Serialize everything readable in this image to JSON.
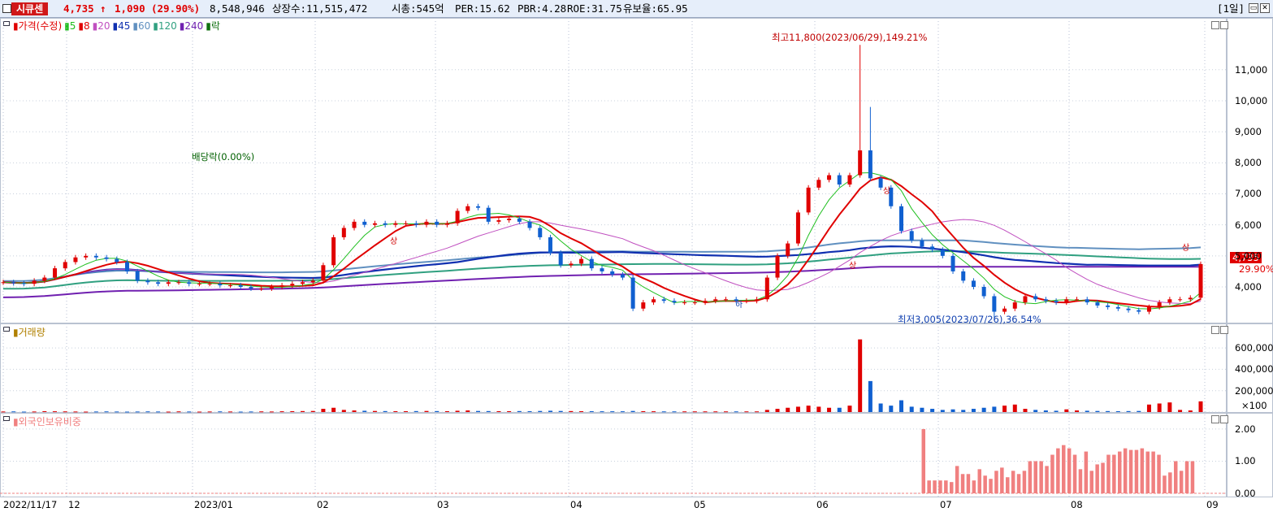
{
  "header": {
    "name": "시큐센",
    "price": "4,735",
    "arrow": "↑",
    "change": "1,090",
    "change_pct": "(29.90%)",
    "volume": "8,548,946",
    "listed_shares": "상장수:11,515,472",
    "market_cap": "시총:545억",
    "per": "PER:15.62",
    "pbr": "PBR:4.28",
    "roe": "ROE:31.75",
    "float": "유보율:65.95",
    "period": "[1일]"
  },
  "price_legend": [
    {
      "label": "가격(수정)",
      "color": "#e00000"
    },
    {
      "label": "5",
      "color": "#1fbf1f"
    },
    {
      "label": "8",
      "color": "#e00000"
    },
    {
      "label": "20",
      "color": "#c050c0"
    },
    {
      "label": "45",
      "color": "#1030b0"
    },
    {
      "label": "60",
      "color": "#6090c0"
    },
    {
      "label": "120",
      "color": "#30a080"
    },
    {
      "label": "240",
      "color": "#7020b0"
    },
    {
      "label": "락",
      "color": "#107010"
    }
  ],
  "volume_legend": {
    "label": "거래량",
    "color": "#b08000"
  },
  "foreign_legend": {
    "label": "외국인보유비중",
    "color": "#f08080"
  },
  "annotations": {
    "high": "최고11,800(2023/06/29),149.21%",
    "low": "최저3,005(2023/07/26),36.54%",
    "dividend": "배당락(0.00%)",
    "current_price": "4,735",
    "current_pct": "29.90%",
    "limit_up": "상",
    "limit_down": "하"
  },
  "chart_data": [
    {
      "type": "candlestick",
      "panel": "price",
      "x": [
        "2022/11/17",
        "12",
        "2023/01",
        "02",
        "03",
        "04",
        "05",
        "06",
        "07",
        "08",
        "09"
      ],
      "y_ticks": [
        "4,000",
        "5,000",
        "6,000",
        "7,000",
        "8,000",
        "9,000",
        "10,000",
        "11,000"
      ],
      "ylim": [
        2900,
        12200
      ],
      "close_series": [
        4150,
        4120,
        4100,
        4200,
        4300,
        4600,
        4800,
        4950,
        5000,
        4950,
        4900,
        4800,
        4500,
        4200,
        4150,
        4100,
        4150,
        4150,
        4100,
        4100,
        4100,
        4050,
        4050,
        4000,
        3950,
        3950,
        4000,
        4050,
        4100,
        4150,
        4200,
        4700,
        5600,
        5900,
        6100,
        6000,
        6050,
        6000,
        6050,
        6050,
        6000,
        6100,
        6000,
        6050,
        6450,
        6600,
        6550,
        6100,
        6150,
        6200,
        6100,
        5900,
        5600,
        5100,
        4700,
        4750,
        4900,
        4600,
        4500,
        4400,
        4300,
        3300,
        3500,
        3600,
        3550,
        3500,
        3500,
        3500,
        3550,
        3600,
        3600,
        3550,
        3550,
        3600,
        4300,
        5000,
        5400,
        6400,
        7200,
        7450,
        7600,
        7300,
        7600,
        8400,
        7500,
        7200,
        6600,
        5800,
        5500,
        5300,
        5200,
        5000,
        4500,
        4200,
        4000,
        3700,
        3200,
        3300,
        3500,
        3700,
        3600,
        3550,
        3500,
        3600,
        3600,
        3500,
        3400,
        3350,
        3300,
        3250,
        3200,
        3350,
        3500,
        3600,
        3600,
        3650,
        4735
      ],
      "high": {
        "value": 11800,
        "date": "2023/06/29",
        "pct": 149.21
      },
      "low": {
        "value": 3005,
        "date": "2023/07/26",
        "pct": 36.54
      },
      "last": 4735
    },
    {
      "type": "bar",
      "panel": "volume",
      "y_ticks": [
        "100",
        "200,000",
        "400,000",
        "600,000"
      ],
      "ylim": [
        0,
        700000
      ],
      "values": [
        5000,
        6000,
        4000,
        5000,
        8000,
        7000,
        6000,
        5000,
        4000,
        5000,
        6000,
        5000,
        4000,
        5000,
        6000,
        5000,
        4000,
        6000,
        5000,
        4000,
        5000,
        6000,
        5000,
        4000,
        5000,
        6000,
        5000,
        7000,
        8000,
        9000,
        10000,
        30000,
        40000,
        20000,
        15000,
        12000,
        10000,
        9000,
        8000,
        8000,
        9000,
        10000,
        9000,
        8000,
        12000,
        15000,
        10000,
        9000,
        8000,
        8000,
        9000,
        8000,
        10000,
        12000,
        10000,
        9000,
        8000,
        8000,
        7000,
        7000,
        7000,
        10000,
        8000,
        7000,
        6000,
        6000,
        6000,
        6000,
        6000,
        6000,
        6000,
        6000,
        6000,
        6000,
        20000,
        30000,
        40000,
        50000,
        60000,
        50000,
        40000,
        40000,
        60000,
        680000,
        290000,
        80000,
        60000,
        110000,
        50000,
        40000,
        30000,
        20000,
        25000,
        20000,
        30000,
        40000,
        50000,
        60000,
        70000,
        30000,
        20000,
        15000,
        12000,
        25000,
        15000,
        12000,
        10000,
        9000,
        8000,
        9000,
        10000,
        70000,
        80000,
        90000,
        20000,
        15000,
        100000
      ],
      "unit": "×100"
    },
    {
      "type": "bar",
      "panel": "foreign_ownership",
      "y_ticks": [
        "0.00",
        "1.00",
        "2.00"
      ],
      "ylim": [
        0,
        2.2
      ],
      "values": [
        2.0,
        0.4,
        0.4,
        0.4,
        0.4,
        0.35,
        0.85,
        0.6,
        0.6,
        0.4,
        0.75,
        0.55,
        0.45,
        0.7,
        0.8,
        0.5,
        0.7,
        0.6,
        0.7,
        1.0,
        1.0,
        1.0,
        0.85,
        1.2,
        1.4,
        1.5,
        1.4,
        1.2,
        0.75,
        1.3,
        0.7,
        0.9,
        0.95,
        1.2,
        1.2,
        1.3,
        1.4,
        1.35,
        1.35,
        1.4,
        1.3,
        1.3,
        1.2,
        0.55,
        0.65,
        1.0,
        0.7,
        1.0,
        1.0
      ]
    }
  ]
}
